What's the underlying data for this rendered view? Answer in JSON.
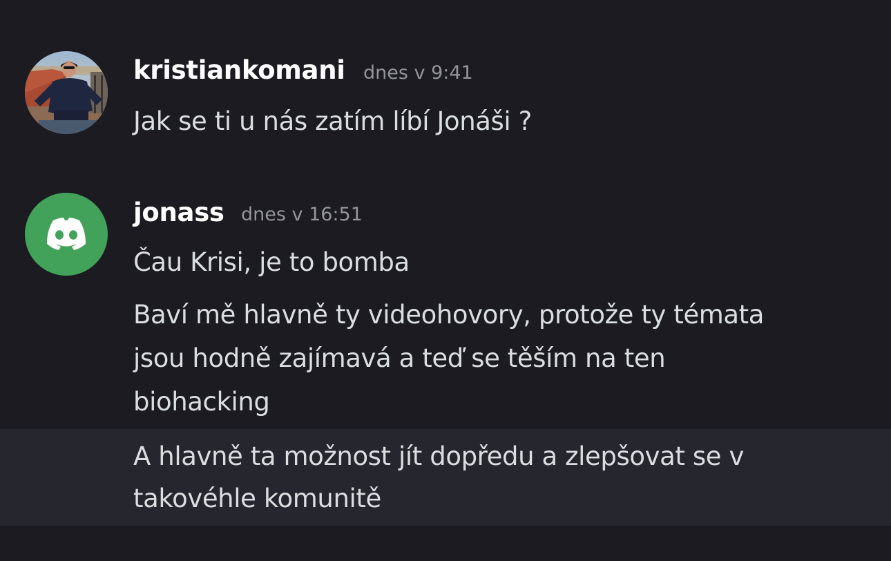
{
  "messages": [
    {
      "author": "kristiankomani",
      "timestamp": "dnes v 9:41",
      "avatar_icon": "user-photo-avatar",
      "lines": [
        "Jak se ti u nás zatím líbí Jonáši ?"
      ]
    },
    {
      "author": "jonass",
      "timestamp": "dnes v 16:51",
      "avatar_icon": "discord-logo-icon",
      "avatar_color": "#43a25a",
      "lines": [
        "Čau Krisi, je to bomba",
        "Baví mě hlavně ty videohovory, protože ty témata",
        "jsou hodně zajímavá a teď se těším na ten",
        "biohacking",
        "A hlavně ta možnost jít dopředu a zlepšovat se v",
        "takovéhle komunitě"
      ]
    }
  ],
  "colors": {
    "background": "#1b1b21",
    "highlight": "#26262e",
    "author": "#ffffff",
    "text": "#dbdee1",
    "timestamp": "#94959c"
  }
}
